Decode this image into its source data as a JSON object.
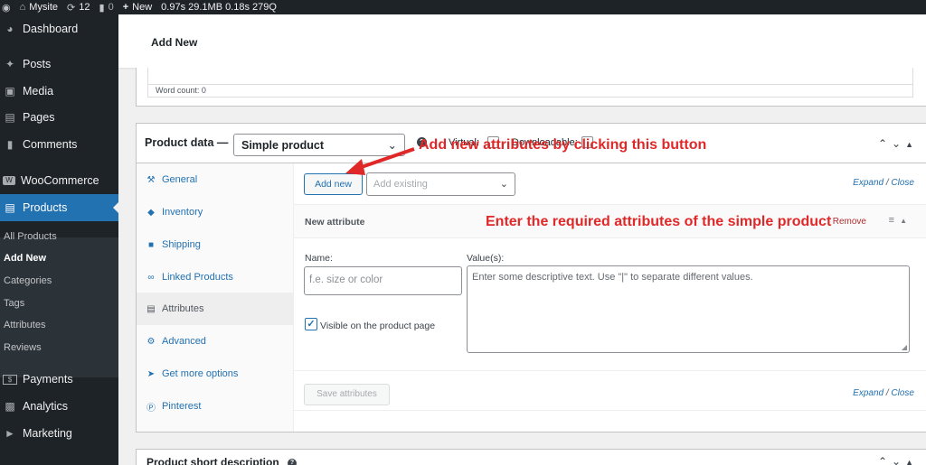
{
  "admin_bar": {
    "site_name": "Mysite",
    "updates_count": "12",
    "comments_count": "0",
    "new_label": "New",
    "stats": "0.97s 29.1MB 0.18s 279Q"
  },
  "sidebar": {
    "menu": [
      {
        "label": "Dashboard",
        "icon": "dashboard-icon"
      },
      {
        "label": "Posts",
        "icon": "pin-icon"
      },
      {
        "label": "Media",
        "icon": "media-icon"
      },
      {
        "label": "Pages",
        "icon": "pages-icon"
      },
      {
        "label": "Comments",
        "icon": "comments-icon"
      },
      {
        "label": "WooCommerce",
        "icon": "woo-icon"
      },
      {
        "label": "Products",
        "icon": "products-icon"
      },
      {
        "label": "Payments",
        "icon": "payments-icon"
      },
      {
        "label": "Analytics",
        "icon": "analytics-icon"
      },
      {
        "label": "Marketing",
        "icon": "megaphone-icon"
      }
    ],
    "submenu": [
      "All Products",
      "Add New",
      "Categories",
      "Tags",
      "Attributes",
      "Reviews"
    ]
  },
  "header": {
    "title": "Add New"
  },
  "editor": {
    "word_count": "Word count: 0"
  },
  "product_data": {
    "title": "Product data —",
    "type_select": "Simple product",
    "virtual_label": "Virtual:",
    "downloadable_label": "Downloadable:",
    "tabs": [
      {
        "label": "General",
        "icon": "wrench-icon"
      },
      {
        "label": "Inventory",
        "icon": "tag-icon"
      },
      {
        "label": "Shipping",
        "icon": "truck-icon"
      },
      {
        "label": "Linked Products",
        "icon": "link-icon"
      },
      {
        "label": "Attributes",
        "icon": "list-icon"
      },
      {
        "label": "Advanced",
        "icon": "gear-icon"
      },
      {
        "label": "Get more options",
        "icon": "plugin-icon"
      },
      {
        "label": "Pinterest",
        "icon": "pinterest-icon"
      }
    ],
    "active_tab": "Attributes",
    "add_new_button": "Add new",
    "add_existing_placeholder": "Add existing",
    "expand_label": "Expand",
    "close_label": "Close",
    "separator": "/",
    "attribute": {
      "heading": "New attribute",
      "remove_label": "Remove",
      "name_label": "Name:",
      "name_placeholder": "f.e. size or color",
      "values_label": "Value(s):",
      "values_placeholder": "Enter some descriptive text. Use \"|\" to separate different values.",
      "visible_label": "Visible on the product page",
      "visible_checked": true
    },
    "save_button": "Save attributes"
  },
  "short_description": {
    "title": "Product short description"
  },
  "annotations": {
    "arrow_note": "Add new attributes by clicking this button",
    "attributes_note": "Enter the required attributes of the simple product",
    "color": "#e02828"
  }
}
